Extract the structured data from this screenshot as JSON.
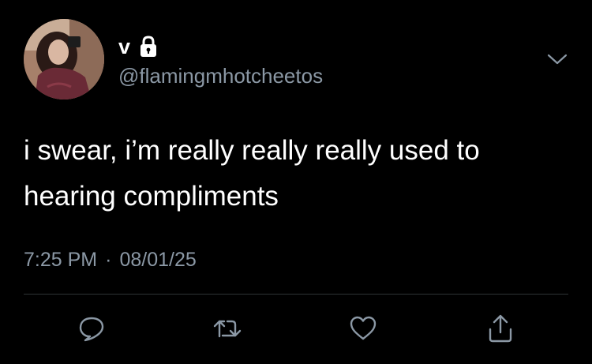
{
  "colors": {
    "background": "#000000",
    "text": "#ffffff",
    "secondary_text": "#8b98a5",
    "icon": "#8b98a5",
    "divider": "#2f3336"
  },
  "user": {
    "display_name": "v",
    "handle": "@flamingmhotcheetos",
    "protected": true,
    "verified_icon": "lock-icon"
  },
  "tweet": {
    "text": "i swear, i’m really really really used to hearing compliments",
    "time": "7:25 PM",
    "separator": "·",
    "date": "08/01/25"
  },
  "actions": [
    {
      "name": "reply",
      "icon": "speech-bubble-icon"
    },
    {
      "name": "retweet",
      "icon": "retweet-icon"
    },
    {
      "name": "like",
      "icon": "heart-icon"
    },
    {
      "name": "share",
      "icon": "share-icon"
    }
  ],
  "menu": {
    "icon": "chevron-down-icon"
  }
}
